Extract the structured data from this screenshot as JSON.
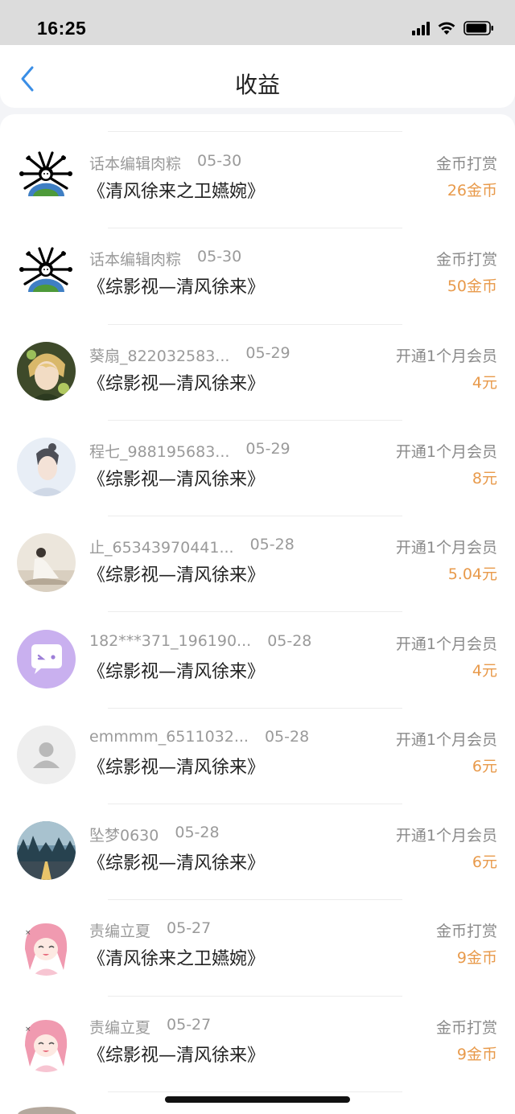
{
  "status": {
    "time": "16:25"
  },
  "header": {
    "title": "收益"
  },
  "rows": [
    {
      "user": "话本编辑肉粽",
      "date": "05-30",
      "book": "《清风徐来之卫嬿婉》",
      "type": "金币打赏",
      "amount": "26金币",
      "avatar": "spider-logo-icon"
    },
    {
      "user": "话本编辑肉粽",
      "date": "05-30",
      "book": "《综影视—清风徐来》",
      "type": "金币打赏",
      "amount": "50金币",
      "avatar": "spider-logo-icon"
    },
    {
      "user": "葵扇_822032583...",
      "date": "05-29",
      "book": "《综影视—清风徐来》",
      "type": "开通1个月会员",
      "amount": "4元",
      "avatar": "anime-boy-avatar"
    },
    {
      "user": "程七_988195683...",
      "date": "05-29",
      "book": "《综影视—清风徐来》",
      "type": "开通1个月会员",
      "amount": "8元",
      "avatar": "girl-photo-avatar"
    },
    {
      "user": "止_65343970441...",
      "date": "05-28",
      "book": "《综影视—清风徐来》",
      "type": "开通1个月会员",
      "amount": "5.04元",
      "avatar": "person-photo-avatar"
    },
    {
      "user": "182***371_196190...",
      "date": "05-28",
      "book": "《综影视—清风徐来》",
      "type": "开通1个月会员",
      "amount": "4元",
      "avatar": "chat-bubble-avatar"
    },
    {
      "user": "emmmm_6511032...",
      "date": "05-28",
      "book": "《综影视—清风徐来》",
      "type": "开通1个月会员",
      "amount": "6元",
      "avatar": "default-user-avatar"
    },
    {
      "user": "坠梦0630",
      "date": "05-28",
      "book": "《综影视—清风徐来》",
      "type": "开通1个月会员",
      "amount": "6元",
      "avatar": "road-landscape-avatar"
    },
    {
      "user": "责编立夏",
      "date": "05-27",
      "book": "《清风徐来之卫嬿婉》",
      "type": "金币打赏",
      "amount": "9金币",
      "avatar": "pink-anime-girl-avatar"
    },
    {
      "user": "责编立夏",
      "date": "05-27",
      "book": "《综影视—清风徐来》",
      "type": "金币打赏",
      "amount": "9金币",
      "avatar": "pink-anime-girl-avatar"
    }
  ],
  "colors": {
    "accent": "#3a8ee6",
    "amount": "#e89a4b",
    "secondary_text": "#9a9a9a"
  }
}
